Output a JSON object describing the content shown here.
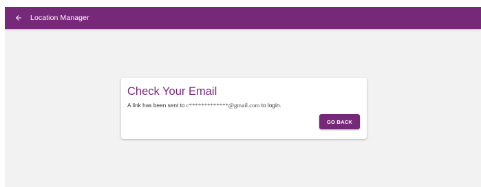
{
  "app_bar": {
    "back_icon": "arrow-left-icon",
    "title": "Location Manager"
  },
  "card": {
    "title": "Check Your Email",
    "message_prefix": "A link has been sent to",
    "email": "c*************@gmail.com",
    "message_suffix": "to login.",
    "button_label": "GO BACK"
  },
  "colors": {
    "brand_purple": "#762979",
    "title_purple": "#7b2a7e",
    "background": "#f2f2f2",
    "card": "#ffffff"
  }
}
